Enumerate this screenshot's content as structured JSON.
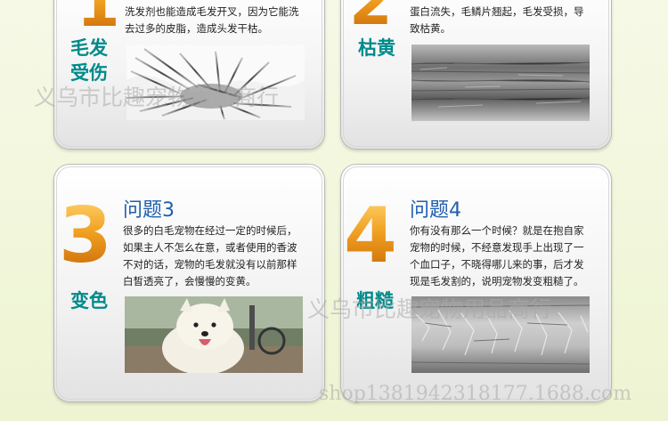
{
  "cards": [
    {
      "label": "毛发受伤",
      "label_line1": "毛发",
      "label_line2": "受伤",
      "desc_lines": [
        "洗发剂也能造成毛发开叉，因为它能洗",
        "去过多的皮脂，造成头发干枯。"
      ]
    },
    {
      "label": "枯黄",
      "desc_lines": [
        "蛋白流失，毛鳞片翘起，毛发受损，导",
        "致枯黄。"
      ]
    },
    {
      "number": "3",
      "question": "问题3",
      "label": "变色",
      "desc_lines": [
        "很多的白毛宠物在经过一定的时候后，",
        "如果主人不怎么在意，或者使用的香波",
        "不对的话，宠物的毛发就没有以前那样",
        "白皙透亮了，会慢慢的变黄。"
      ]
    },
    {
      "number": "4",
      "question": "问题4",
      "label": "粗糙",
      "desc_lines": [
        "你有没有那么一个时候？就是在抱自家",
        "宠物的时候，不经意发现手上出现了一",
        "个血口子，不晓得哪儿来的事，后才发",
        "现是毛发割的，说明宠物发变粗糙了。"
      ]
    }
  ],
  "watermarks": {
    "shop_name": "义乌市比趣宠物用品商行",
    "shop_url": "shop1381942318177.1688.com"
  },
  "colors": {
    "accent_orange": "#f0a021",
    "title_teal": "#008a8a",
    "question_blue": "#1f5fae"
  }
}
